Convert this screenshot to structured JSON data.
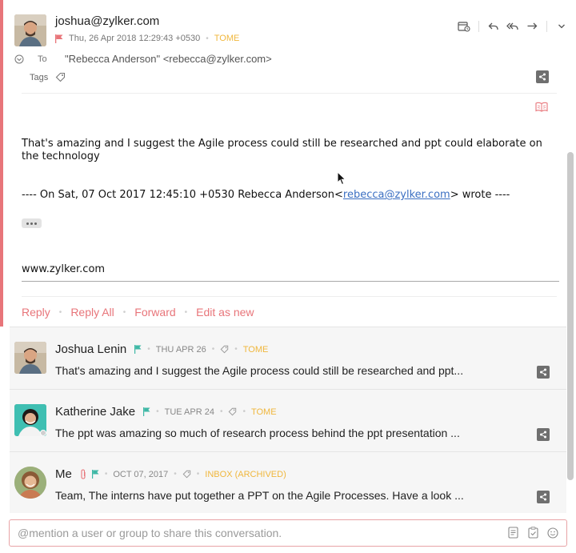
{
  "open_message": {
    "sender": "joshua@zylker.com",
    "date": "Thu, 26 Apr 2018 12:29:43 +0530",
    "folder": "TOME",
    "to_label": "To",
    "to_value": "\"Rebecca Anderson\" <rebecca@zylker.com>",
    "tags_label": "Tags",
    "body": "That's amazing  and I suggest the Agile process could still be researched and ppt could elaborate on the technology",
    "quote_prefix": "---- On Sat, 07 Oct 2017 12:45:10 +0530 Rebecca Anderson<",
    "quote_link": "rebecca@zylker.com",
    "quote_suffix": "> wrote ----",
    "signature": "www.zylker.com",
    "actions": {
      "reply": "Reply",
      "reply_all": "Reply All",
      "forward": "Forward",
      "edit_as_new": "Edit as new"
    },
    "icons": [
      "calendar-icon",
      "reply-icon",
      "reply-all-icon",
      "forward-icon",
      "more-chevron-icon",
      "share-icon",
      "reading-mode-icon",
      "flag-icon",
      "tag-icon",
      "expand-icon"
    ]
  },
  "thread": [
    {
      "name": "Joshua Lenin",
      "date": "THU APR 26",
      "folder": "TOME",
      "snippet": "That's amazing and I suggest the Agile process could still be researched and ppt..."
    },
    {
      "name": "Katherine Jake",
      "date": "TUE APR 24",
      "folder": "TOME",
      "snippet": "The ppt was amazing so much of research process behind the ppt presentation ..."
    },
    {
      "name": "Me",
      "date": "OCT 07, 2017",
      "folder": "INBOX (ARCHIVED)",
      "snippet": "Team, The interns have put together a PPT on the Agile Processes. Have a look ..."
    }
  ],
  "mention": {
    "placeholder": "@mention a user or group to share this conversation."
  },
  "colors": {
    "accent": "#e8757a",
    "folder": "#f0b73d",
    "flag_red": "#e8757a",
    "flag_teal": "#3fb8a6",
    "link": "#3b6fc2"
  }
}
